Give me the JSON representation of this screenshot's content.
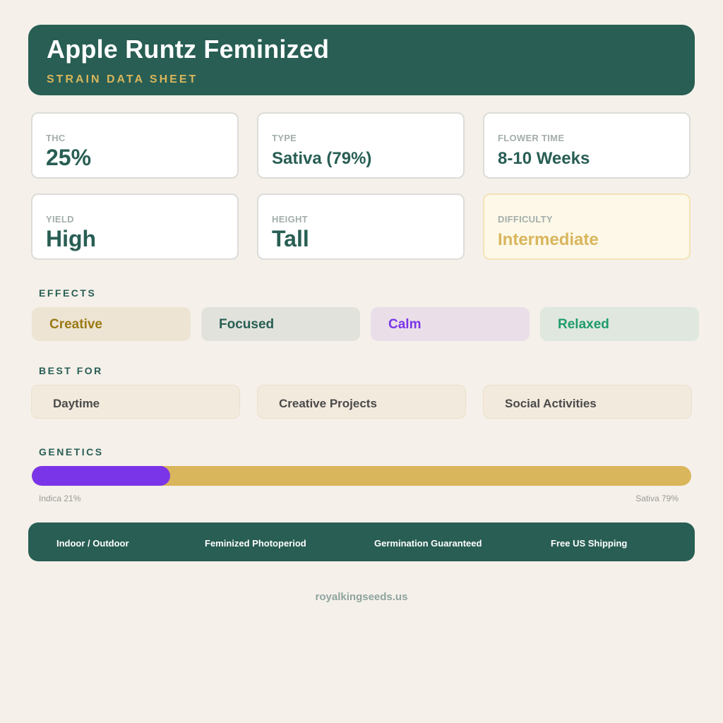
{
  "header": {
    "title": "Apple Runtz Feminized",
    "subtitle": "STRAIN DATA SHEET"
  },
  "stats": [
    {
      "label": "THC",
      "value": "25%"
    },
    {
      "label": "TYPE",
      "value": "Sativa (79%)"
    },
    {
      "label": "FLOWER TIME",
      "value": "8-10 Weeks"
    },
    {
      "label": "YIELD",
      "value": "High"
    },
    {
      "label": "HEIGHT",
      "value": "Tall"
    },
    {
      "label": "DIFFICULTY",
      "value": "Intermediate"
    }
  ],
  "effects": {
    "title": "EFFECTS",
    "items": [
      {
        "label": "Creative",
        "color": "#9a7a14",
        "bg": "#ede4d4"
      },
      {
        "label": "Focused",
        "color": "#285e54",
        "bg": "#e2e2dc"
      },
      {
        "label": "Calm",
        "color": "#7b35e8",
        "bg": "#eadfe8"
      },
      {
        "label": "Relaxed",
        "color": "#1f9b6a",
        "bg": "#dfe7df"
      }
    ]
  },
  "best_for": {
    "title": "BEST FOR",
    "items": [
      "Daytime",
      "Creative Projects",
      "Social Activities"
    ]
  },
  "genetics": {
    "title": "GENETICS",
    "indica_label": "Indica 21%",
    "sativa_label": "Sativa 79%",
    "indica_fraction": 0.21,
    "indica_color": "#7b35e8",
    "sativa_color": "#d9b65c"
  },
  "features": [
    "Indoor / Outdoor",
    "Feminized Photoperiod",
    "Germination Guaranteed",
    "Free US Shipping"
  ],
  "website": "royalkingseeds.us",
  "colors": {
    "primary": "#285e54",
    "accent": "#d9b65c",
    "background": "#f5f0ea"
  }
}
